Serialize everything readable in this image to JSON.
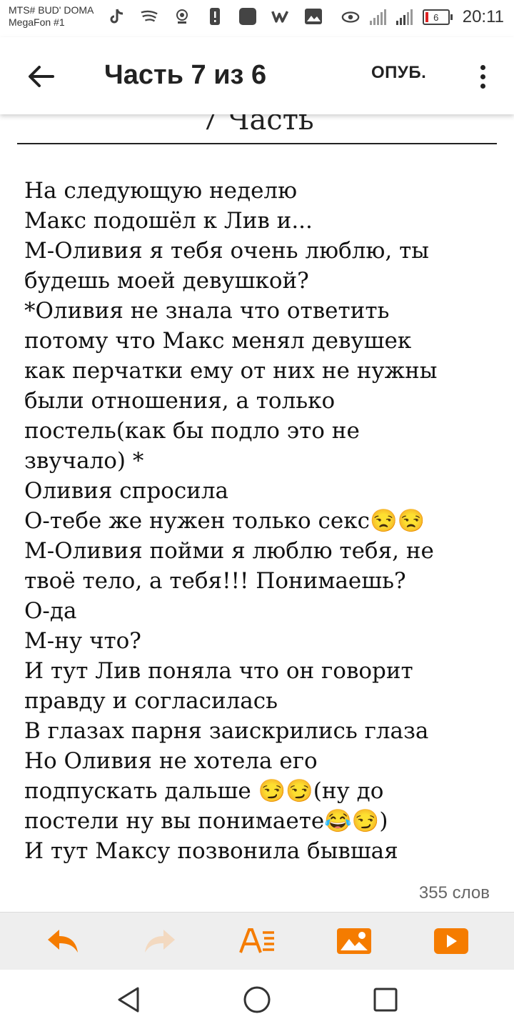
{
  "status_bar": {
    "carrier_line1": "MTS# BUD' DOMA",
    "carrier_line2": "MegaFon #1",
    "time": "20:11",
    "battery_level": "6",
    "icons": [
      "tiktok-icon",
      "swirl-icon",
      "radio-icon",
      "alert-icon",
      "square-icon",
      "w-icon",
      "image-icon",
      "eye-icon",
      "signal-icon",
      "signal-icon",
      "battery-icon"
    ]
  },
  "app_bar": {
    "title": "Часть 7 из 6",
    "publish_label": "ОПУБ."
  },
  "editor": {
    "part_heading": "7 Часть",
    "lines": [
      "На следующую неделю",
      "Макс подошёл к Лив и...",
      "М-Оливия я тебя очень люблю, ты",
      "будешь моей девушкой?",
      "*Оливия не знала что ответить",
      "потому что Макс менял девушек",
      "как перчатки ему от них не нужны",
      "были отношения, а только",
      "постель(как бы подло это не",
      "звучало) *",
      "Оливия спросила",
      "О-тебе же нужен только секс😒😒",
      "М-Оливия пойми я люблю тебя, не",
      "твоё тело, а тебя!!! Понимаешь?",
      "О-да",
      "М-ну что?",
      "И тут Лив поняла что он говорит",
      "правду и согласилась",
      "В глазах парня заискрились глаза",
      "Но Оливия не хотела его",
      "подпускать дальше 😏😏(ну до",
      "постели ну вы понимаете😂😏)",
      "И тут Максу позвонила бывшая"
    ],
    "word_count": "355 слов"
  },
  "colors": {
    "accent": "#f57c00",
    "disabled": "#f3d9c0",
    "toolbar_bg": "#eeeeee",
    "text": "#111111"
  }
}
